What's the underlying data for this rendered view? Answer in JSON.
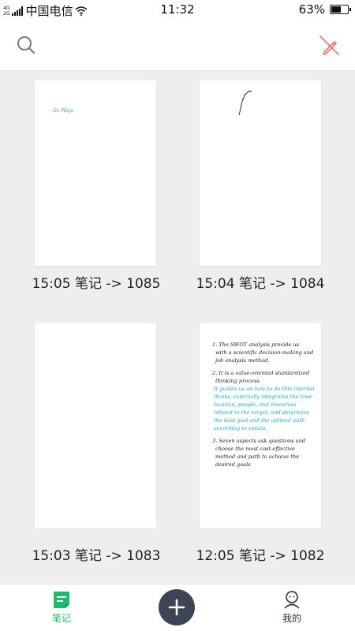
{
  "status_bar": {
    "network_top": "4G",
    "network_bottom": "2G",
    "carrier": "中国电信",
    "time": "11:32",
    "battery_percent": "63%",
    "battery_level": 0.63
  },
  "toolbar": {
    "search_icon": "search-icon",
    "edit_icon": "pencil-crossed-icon",
    "edit_icon_color": "#e57373"
  },
  "notes": [
    {
      "title": "15:05 笔记 -> 1085",
      "preview_text": "Go Ways",
      "preview_color": "#4caf50"
    },
    {
      "title": "15:04 笔记 -> 1084"
    },
    {
      "title": "15:03 笔记 -> 1083"
    },
    {
      "title": "12:05 笔记 -> 1082",
      "preview_lines": [
        "1. The SWOT analysis provide us",
        "with a scientific decision-making and",
        "job analysis method.",
        "2. It is a value-oriented standardized",
        "thinking process.",
        "It guides us on how to do this internal",
        "thinks, externally integrates the time",
        "location, people, and resources",
        "related to the target, and determine",
        "the best goal and the optimal path",
        "according to values.",
        "3. Seven aspects ask questions and",
        "choose the most cost-effective",
        "method and path to achieve the",
        "desired goals"
      ]
    }
  ],
  "bottom_nav": {
    "notes_label": "笔记",
    "me_label": "我的",
    "active_color": "#1fba6a",
    "fab_color": "#3c4456"
  }
}
